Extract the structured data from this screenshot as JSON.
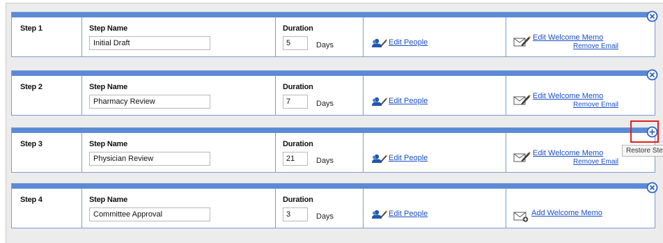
{
  "labels": {
    "step_name": "Step Name",
    "duration": "Duration",
    "days": "Days",
    "edit_people": "Edit People",
    "remove_email": "Remove Email"
  },
  "steps": [
    {
      "step": "Step 1",
      "name": "Initial Draft",
      "duration": "5",
      "memo_link": "Edit Welcome Memo",
      "has_remove_email": true,
      "control": "remove",
      "memo_icon": "envelope-pen-icon"
    },
    {
      "step": "Step 2",
      "name": "Pharmacy Review",
      "duration": "7",
      "memo_link": "Edit Welcome Memo",
      "has_remove_email": true,
      "control": "remove",
      "memo_icon": "envelope-pen-icon"
    },
    {
      "step": "Step 3",
      "name": "Physician Review",
      "duration": "21",
      "memo_link": "Edit Welcome Memo",
      "has_remove_email": true,
      "control": "restore",
      "memo_icon": "envelope-pen-icon"
    },
    {
      "step": "Step 4",
      "name": "Committee Approval",
      "duration": "3",
      "memo_link": "Add Welcome Memo",
      "has_remove_email": false,
      "control": "remove",
      "memo_icon": "envelope-add-icon"
    }
  ],
  "tooltip": {
    "text": "Restore Step"
  },
  "colors": {
    "bar": "#5b8ad6",
    "border": "#7a9ccd",
    "link": "#1a4fc4",
    "highlight": "#e02020"
  }
}
